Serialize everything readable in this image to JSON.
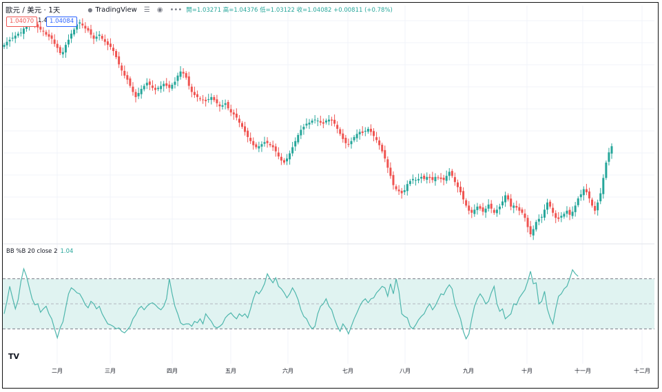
{
  "header": {
    "symbol": "歐元 / 美元 · 1天",
    "brand": "TradingView",
    "ohlc": "開=1.03271 高=1.04376 低=1.03122 收=1.04082 +0.00811 (+0.78%)"
  },
  "price_boxes": {
    "sell": "1.04070",
    "spread": "1.4",
    "buy": "1.04084"
  },
  "indicator": {
    "label": "BB %B 20 close 2",
    "value": "1.04"
  },
  "icons": {
    "compare": "compare-icon",
    "eye": "eye-icon",
    "more": "more-icon",
    "logo": "tradingview-logo-icon"
  },
  "colors": {
    "up": "#26a69a",
    "down": "#ef5350",
    "band_fill": "#e0f3f1",
    "line": "#4db6ac"
  },
  "chart_data": [
    {
      "type": "candlestick",
      "title": "歐元 / 美元 · 1天",
      "x_tick_labels": [
        "二月",
        "三月",
        "四月",
        "五月",
        "六月",
        "七月",
        "八月",
        "九月",
        "十月",
        "十一月",
        "十二月"
      ],
      "ylim": [
        0.955,
        1.165
      ],
      "y_tick_labels": [],
      "grid": true,
      "series": [
        {
          "name": "close",
          "values": [
            1.14,
            1.143,
            1.145,
            1.147,
            1.149,
            1.151,
            1.152,
            1.156,
            1.158,
            1.161,
            1.163,
            1.16,
            1.157,
            1.155,
            1.153,
            1.15,
            1.148,
            1.146,
            1.141,
            1.137,
            1.132,
            1.133,
            1.14,
            1.145,
            1.151,
            1.155,
            1.16,
            1.162,
            1.159,
            1.156,
            1.154,
            1.15,
            1.146,
            1.148,
            1.15,
            1.146,
            1.143,
            1.14,
            1.138,
            1.134,
            1.128,
            1.121,
            1.115,
            1.11,
            1.106,
            1.1,
            1.094,
            1.089,
            1.093,
            1.097,
            1.1,
            1.103,
            1.101,
            1.098,
            1.096,
            1.098,
            1.1,
            1.102,
            1.1,
            1.098,
            1.101,
            1.104,
            1.11,
            1.114,
            1.112,
            1.108,
            1.1,
            1.094,
            1.091,
            1.089,
            1.087,
            1.086,
            1.085,
            1.087,
            1.089,
            1.086,
            1.083,
            1.08,
            1.081,
            1.083,
            1.078,
            1.074,
            1.072,
            1.069,
            1.064,
            1.06,
            1.055,
            1.05,
            1.046,
            1.042,
            1.04,
            1.041,
            1.043,
            1.045,
            1.044,
            1.042,
            1.04,
            1.036,
            1.031,
            1.027,
            1.025,
            1.029,
            1.034,
            1.04,
            1.046,
            1.052,
            1.057,
            1.06,
            1.063,
            1.064,
            1.066,
            1.067,
            1.066,
            1.064,
            1.063,
            1.066,
            1.067,
            1.066,
            1.063,
            1.058,
            1.053,
            1.048,
            1.044,
            1.043,
            1.046,
            1.05,
            1.053,
            1.055,
            1.054,
            1.056,
            1.058,
            1.055,
            1.051,
            1.047,
            1.042,
            1.036,
            1.029,
            1.02,
            1.012,
            1.003,
            0.999,
            0.997,
            0.995,
            0.998,
            1.004,
            1.007,
            1.009,
            1.008,
            1.009,
            1.011,
            1.009,
            1.011,
            1.01,
            1.008,
            1.011,
            1.01,
            1.009,
            1.008,
            1.012,
            1.016,
            1.012,
            1.006,
            1.001,
            0.996,
            0.989,
            0.983,
            0.978,
            0.976,
            0.979,
            0.982,
            0.98,
            0.977,
            0.98,
            0.984,
            0.98,
            0.976,
            0.979,
            0.982,
            0.987,
            0.993,
            0.989,
            0.982,
            0.983,
            0.981,
            0.978,
            0.976,
            0.971,
            0.962,
            0.955,
            0.96,
            0.967,
            0.97,
            0.972,
            0.979,
            0.986,
            0.982,
            0.976,
            0.971,
            0.97,
            0.973,
            0.975,
            0.978,
            0.974,
            0.977,
            0.983,
            0.99,
            0.994,
            0.999,
            0.996,
            0.99,
            0.983,
            0.978,
            0.986,
            0.995,
            1.01,
            1.025,
            1.035,
            1.041
          ]
        }
      ]
    },
    {
      "type": "line",
      "title": "BB %B 20 close 2",
      "ylim": [
        -0.45,
        1.45
      ],
      "bands": [
        0,
        0.5,
        1
      ],
      "series": [
        {
          "name": "BB %B 20 close 2",
          "values": [
            0.3,
            0.55,
            0.85,
            0.62,
            0.4,
            0.58,
            0.95,
            1.2,
            1.05,
            0.82,
            0.6,
            0.48,
            0.5,
            0.33,
            0.4,
            0.45,
            0.3,
            0.2,
            0.0,
            -0.18,
            0.02,
            0.14,
            0.42,
            0.7,
            0.82,
            0.78,
            0.72,
            0.7,
            0.6,
            0.48,
            0.42,
            0.55,
            0.5,
            0.4,
            0.45,
            0.3,
            0.2,
            0.1,
            0.08,
            0.05,
            0.0,
            0.02,
            -0.05,
            -0.08,
            -0.02,
            0.05,
            0.2,
            0.28,
            0.4,
            0.45,
            0.38,
            0.45,
            0.5,
            0.52,
            0.48,
            0.42,
            0.38,
            0.45,
            0.6,
            1.0,
            0.7,
            0.45,
            0.3,
            0.12,
            0.08,
            0.1,
            0.1,
            0.05,
            0.15,
            0.12,
            0.2,
            0.1,
            0.3,
            0.22,
            0.15,
            0.05,
            0.02,
            0.05,
            0.1,
            0.22,
            0.28,
            0.32,
            0.25,
            0.2,
            0.3,
            0.25,
            0.3,
            0.22,
            0.4,
            0.6,
            0.75,
            0.7,
            0.78,
            0.9,
            1.1,
            1.0,
            0.92,
            1.02,
            0.85,
            0.8,
            0.72,
            0.62,
            0.7,
            0.82,
            0.72,
            0.58,
            0.38,
            0.25,
            0.2,
            0.08,
            0.0,
            0.05,
            0.3,
            0.45,
            0.5,
            0.6,
            0.45,
            0.38,
            0.2,
            0.05,
            -0.05,
            0.1,
            0.02,
            -0.1,
            0.05,
            0.2,
            0.32,
            0.45,
            0.55,
            0.6,
            0.52,
            0.6,
            0.62,
            0.72,
            0.78,
            0.85,
            0.82,
            0.65,
            0.9,
            0.7,
            1.0,
            0.75,
            0.3,
            0.25,
            0.22,
            0.05,
            0.0,
            0.08,
            0.18,
            0.25,
            0.3,
            0.42,
            0.5,
            0.38,
            0.46,
            0.58,
            0.7,
            0.68,
            0.8,
            0.88,
            0.8,
            0.5,
            0.35,
            0.2,
            -0.05,
            -0.2,
            -0.1,
            0.2,
            0.45,
            0.6,
            0.7,
            0.62,
            0.5,
            0.55,
            0.72,
            0.85,
            0.5,
            0.35,
            0.4,
            0.2,
            0.25,
            0.3,
            0.5,
            0.48,
            0.62,
            0.7,
            0.78,
            0.95,
            1.15,
            0.9,
            0.92,
            0.5,
            0.55,
            0.75,
            0.4,
            0.22,
            0.1,
            0.4,
            0.65,
            0.7,
            0.8,
            0.85,
            1.0,
            1.18,
            1.1,
            1.05
          ]
        }
      ]
    }
  ]
}
